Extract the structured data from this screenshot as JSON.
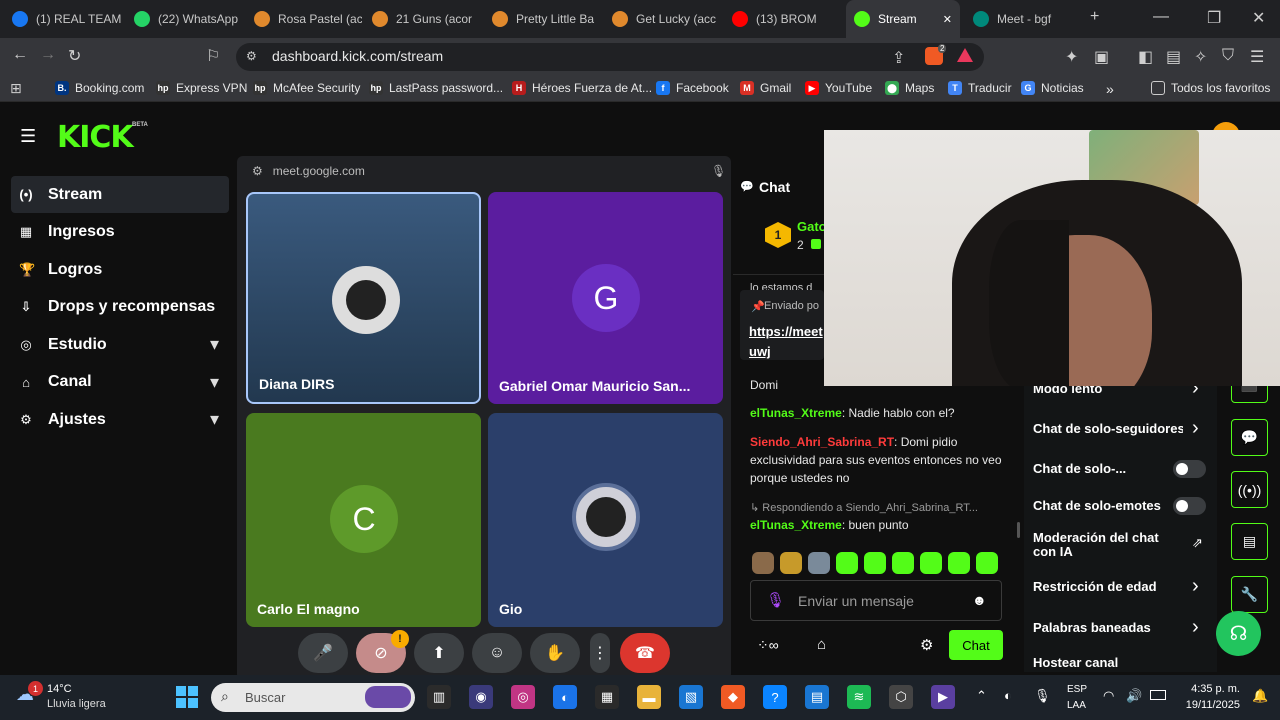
{
  "browser": {
    "tabs": [
      {
        "label": "(1) REAL TEAM",
        "icon": "facebook-icon",
        "color": "#1877f2"
      },
      {
        "label": "(22) WhatsApp",
        "icon": "whatsapp-icon",
        "color": "#25d366"
      },
      {
        "label": "Rosa Pastel (ac",
        "icon": "brave-shield-icon",
        "color": "#e0892d"
      },
      {
        "label": "21 Guns (acor",
        "icon": "brave-shield-icon",
        "color": "#e0892d"
      },
      {
        "label": "Pretty Little Ba",
        "icon": "brave-shield-icon",
        "color": "#e0892d"
      },
      {
        "label": "Get Lucky (acc",
        "icon": "brave-shield-icon",
        "color": "#e0892d"
      },
      {
        "label": "(13) BROM",
        "icon": "youtube-icon",
        "color": "#ff0000"
      },
      {
        "label": "Stream",
        "icon": "kick-icon",
        "color": "#53fc18",
        "active": true
      },
      {
        "label": "Meet - bgf",
        "icon": "meet-icon",
        "color": "#00897b"
      }
    ],
    "url": "dashboard.kick.com/stream",
    "brave_badge": "2",
    "bookmarks": [
      {
        "label": "Booking.com",
        "icon": "booking-icon",
        "color": "#003580",
        "glyph": "B."
      },
      {
        "label": "Express VPN",
        "icon": "hp-icon",
        "color": "#333",
        "glyph": "hp"
      },
      {
        "label": "McAfee Security",
        "icon": "hp-icon",
        "color": "#333",
        "glyph": "hp"
      },
      {
        "label": "LastPass password...",
        "icon": "hp-icon",
        "color": "#333",
        "glyph": "hp"
      },
      {
        "label": "Héroes Fuerza de At...",
        "icon": "heroes-icon",
        "color": "#b71c1c",
        "glyph": "H"
      },
      {
        "label": "Facebook",
        "icon": "facebook-icon",
        "color": "#1877f2",
        "glyph": "f"
      },
      {
        "label": "Gmail",
        "icon": "gmail-icon",
        "color": "#d93025",
        "glyph": "M"
      },
      {
        "label": "YouTube",
        "icon": "youtube-icon",
        "color": "#ff0000",
        "glyph": "▶"
      },
      {
        "label": "Maps",
        "icon": "maps-icon",
        "color": "#34a853",
        "glyph": "⬤"
      },
      {
        "label": "Traducir",
        "icon": "translate-icon",
        "color": "#4285f4",
        "glyph": "T"
      },
      {
        "label": "Noticias",
        "icon": "news-icon",
        "color": "#4285f4",
        "glyph": "G"
      }
    ],
    "bookmarks_more": "»",
    "all_favorites": "Todos los favoritos"
  },
  "kick": {
    "logo": "KICK",
    "beta": "BETA",
    "sidebar": [
      {
        "label": "Stream",
        "icon": "stream-icon",
        "glyph": "(•)",
        "active": true
      },
      {
        "label": "Ingresos",
        "icon": "revenue-icon",
        "glyph": "▦"
      },
      {
        "label": "Logros",
        "icon": "trophy-icon",
        "glyph": "🏆"
      },
      {
        "label": "Drops y recompensas",
        "icon": "drops-icon",
        "glyph": "⇩"
      },
      {
        "label": "Estudio",
        "icon": "studio-icon",
        "glyph": "◎",
        "chevron": true
      },
      {
        "label": "Canal",
        "icon": "channel-icon",
        "glyph": "⌂",
        "chevron": true
      },
      {
        "label": "Ajustes",
        "icon": "settings-icon",
        "glyph": "⚙",
        "chevron": true
      }
    ],
    "chat": {
      "title": "Chat",
      "top_user": "Gato",
      "top_rank": "1",
      "top_count": "2",
      "partial_line": "lo estamos d",
      "pinned_label": "Enviado po",
      "pinned_link_1": "https://meet",
      "pinned_link_2": "uwj",
      "messages": [
        {
          "user": "",
          "text": "Domi",
          "user_class": "u-green"
        },
        {
          "user": "elTunas_Xtreme",
          "text": "Nadie hablo con el?",
          "user_class": "u-green"
        },
        {
          "user": "Siendo_Ahri_Sabrina_RT",
          "text": "Domi pidio exclusividad para sus eventos entonces no veo porque ustedes no",
          "user_class": "u-red"
        }
      ],
      "reply_to": "Respondiendo a Siendo_Ahri_Sabrina_RT...",
      "reply_user": "elTunas_Xtreme",
      "reply_text": "buen punto",
      "input_placeholder": "Enviar un mensaje",
      "send_label": "Chat"
    },
    "chat_settings": [
      {
        "label": "Modo lento",
        "control": "chevron"
      },
      {
        "label": "Chat de solo-seguidores",
        "control": "chevron"
      },
      {
        "label": "Chat de solo-...",
        "control": "toggle"
      },
      {
        "label": "Chat de solo-emotes",
        "control": "toggle"
      },
      {
        "label": "Moderación del chat con IA",
        "control": "external"
      },
      {
        "label": "Restricción de edad",
        "control": "chevron"
      },
      {
        "label": "Palabras baneadas",
        "control": "chevron"
      },
      {
        "label": "Hostear canal",
        "control": "none"
      }
    ]
  },
  "meet": {
    "url": "meet.google.com",
    "participants": [
      {
        "name": "Diana DIRS",
        "bg": "#2d4563",
        "avatar": "photo"
      },
      {
        "name": "Gabriel Omar Mauricio San...",
        "bg": "#5b1d9f",
        "avatar": "G",
        "avatar_bg": "#6a2fc2"
      },
      {
        "name": "Carlo El magno",
        "bg": "#4a7a1f",
        "avatar": "C",
        "avatar_bg": "#5e9a2a"
      },
      {
        "name": "Gio",
        "bg": "#2b3f6a",
        "avatar": "photo"
      }
    ],
    "controls": [
      {
        "name": "mic-button",
        "glyph": "🎤"
      },
      {
        "name": "camera-off-button",
        "glyph": "⊘"
      },
      {
        "name": "present-button",
        "glyph": "⬆"
      },
      {
        "name": "reactions-button",
        "glyph": "☺"
      },
      {
        "name": "raise-hand-button",
        "glyph": "✋"
      },
      {
        "name": "more-options-button",
        "glyph": "⋮"
      },
      {
        "name": "leave-call-button",
        "glyph": "☎"
      }
    ],
    "camera_warning": "!"
  },
  "taskbar": {
    "weather_temp": "14°C",
    "weather_desc": "Lluvia ligera",
    "weather_badge": "1",
    "search_placeholder": "Buscar",
    "lang_1": "ESP",
    "lang_2": "LAA",
    "time": "4:35 p. m.",
    "date": "19/11/2025"
  }
}
